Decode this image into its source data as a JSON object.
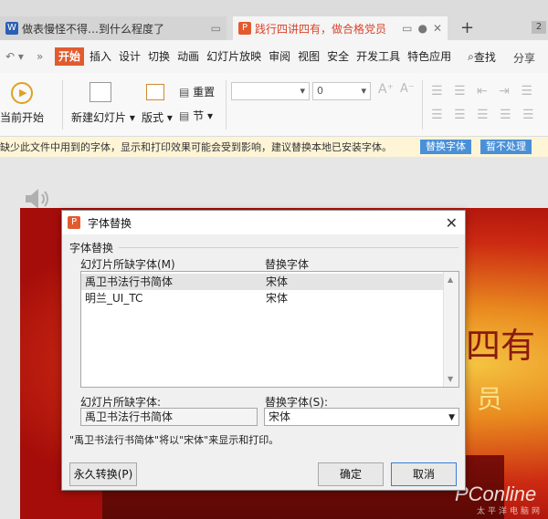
{
  "tabs": [
    {
      "title": "做表慢怪不得…到什么程度了",
      "icon": "W",
      "icon_color": "#2b5fb4"
    },
    {
      "title": "践行四讲四有，做合格党员",
      "icon": "P",
      "icon_color": "#e25b2f"
    }
  ],
  "window_count": "2",
  "menu": {
    "items": [
      "开始",
      "插入",
      "设计",
      "切换",
      "动画",
      "幻灯片放映",
      "审阅",
      "视图",
      "安全",
      "开发工具",
      "特色应用"
    ],
    "search": "查找",
    "share": "分享"
  },
  "ribbon": {
    "play_from_current": "当前开始",
    "new_slide": "新建幻灯片",
    "layout": "版式",
    "reset": "重置",
    "section": "节",
    "font_size": "0"
  },
  "notice": {
    "message": "缺少此文件中用到的字体，显示和打印效果可能会受到影响，建议替换本地已安装字体。",
    "replace_btn": "替换字体",
    "ignore_btn": "暂不处理"
  },
  "slide": {
    "title_fragment": "四有",
    "subtitle_fragment": "员"
  },
  "watermark": {
    "main": "PConline",
    "sub": "太平洋电脑网"
  },
  "dialog": {
    "title": "字体替换",
    "group": "字体替换",
    "col_missing": "幻灯片所缺字体(M)",
    "col_replace": "替换字体",
    "rows": [
      {
        "missing": "禹卫书法行书简体",
        "replace": "宋体"
      },
      {
        "missing": "明兰_UI_TC",
        "replace": "宋体"
      }
    ],
    "missing_label": "幻灯片所缺字体:",
    "missing_value": "禹卫书法行书简体",
    "replace_label": "替换字体(S):",
    "replace_value": "宋体",
    "info": "\"禹卫书法行书简体\"将以\"宋体\"来显示和打印。",
    "permanent_btn": "永久转换(P)",
    "ok_btn": "确定",
    "cancel_btn": "取消"
  }
}
